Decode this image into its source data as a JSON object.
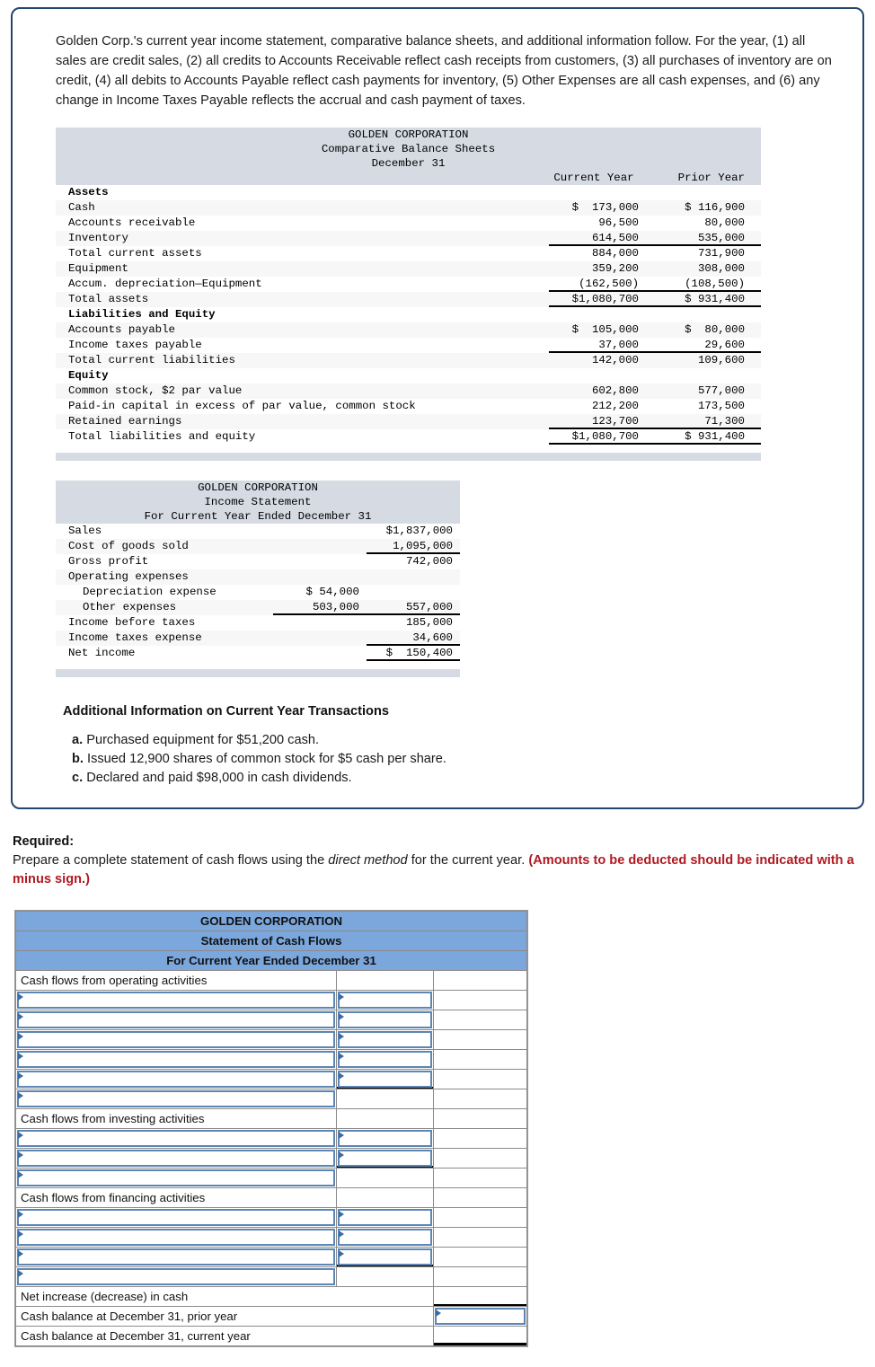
{
  "intro": "Golden Corp.'s current year income statement, comparative balance sheets, and additional information follow. For the year, (1) all sales are credit sales, (2) all credits to Accounts Receivable reflect cash receipts from customers, (3) all purchases of inventory are on credit, (4) all debits to Accounts Payable reflect cash payments for inventory, (5) Other Expenses are all cash expenses, and (6) any change in Income Taxes Payable reflects the accrual and cash payment of taxes.",
  "balance_sheet": {
    "title1": "GOLDEN CORPORATION",
    "title2": "Comparative Balance Sheets",
    "title3": "December 31",
    "col_current": "Current Year",
    "col_prior": "Prior Year",
    "rows": [
      {
        "label": "Assets",
        "bold": true,
        "current": "",
        "prior": ""
      },
      {
        "label": "Cash",
        "current": "$  173,000",
        "prior": "$ 116,900"
      },
      {
        "label": "Accounts receivable",
        "current": "96,500",
        "prior": "80,000"
      },
      {
        "label": "Inventory",
        "current": "614,500",
        "prior": "535,000",
        "rule": "single"
      },
      {
        "label": "Total current assets",
        "current": "884,000",
        "prior": "731,900"
      },
      {
        "label": "Equipment",
        "current": "359,200",
        "prior": "308,000"
      },
      {
        "label": "Accum. depreciation—Equipment",
        "current": "(162,500)",
        "prior": "(108,500)",
        "rule": "single"
      },
      {
        "label": "Total assets",
        "current": "$1,080,700",
        "prior": "$ 931,400",
        "rule": "double"
      },
      {
        "label": "Liabilities and Equity",
        "bold": true,
        "current": "",
        "prior": ""
      },
      {
        "label": "Accounts payable",
        "current": "$  105,000",
        "prior": "$  80,000"
      },
      {
        "label": "Income taxes payable",
        "current": "37,000",
        "prior": "29,600",
        "rule": "single"
      },
      {
        "label": "Total current liabilities",
        "current": "142,000",
        "prior": "109,600"
      },
      {
        "label": "Equity",
        "bold": true,
        "current": "",
        "prior": ""
      },
      {
        "label": "Common stock, $2 par value",
        "current": "602,800",
        "prior": "577,000"
      },
      {
        "label": "Paid-in capital in excess of par value, common stock",
        "current": "212,200",
        "prior": "173,500"
      },
      {
        "label": "Retained earnings",
        "current": "123,700",
        "prior": "71,300",
        "rule": "single"
      },
      {
        "label": "Total liabilities and equity",
        "current": "$1,080,700",
        "prior": "$ 931,400",
        "rule": "double"
      }
    ]
  },
  "income_statement": {
    "title1": "GOLDEN CORPORATION",
    "title2": "Income Statement",
    "title3": "For Current Year Ended December 31",
    "rows": [
      {
        "label": "Sales",
        "indent": false,
        "a": "",
        "b": "$1,837,000"
      },
      {
        "label": "Cost of goods sold",
        "indent": false,
        "a": "",
        "b": "1,095,000",
        "rule": "single"
      },
      {
        "label": "Gross profit",
        "indent": false,
        "a": "",
        "b": "742,000"
      },
      {
        "label": "Operating expenses",
        "indent": false,
        "a": "",
        "b": ""
      },
      {
        "label": "Depreciation expense",
        "indent": true,
        "a": "$ 54,000",
        "b": ""
      },
      {
        "label": "Other expenses",
        "indent": true,
        "a": "503,000",
        "b": "557,000",
        "rule": "single_both"
      },
      {
        "label": "Income before taxes",
        "indent": false,
        "a": "",
        "b": "185,000"
      },
      {
        "label": "Income taxes expense",
        "indent": false,
        "a": "",
        "b": "34,600",
        "rule": "single"
      },
      {
        "label": "Net income",
        "indent": false,
        "a": "",
        "b": "$  150,400",
        "rule": "double"
      }
    ]
  },
  "additional": {
    "heading": "Additional Information on Current Year Transactions",
    "items": [
      {
        "letter": "a.",
        "text": "Purchased equipment for $51,200 cash."
      },
      {
        "letter": "b.",
        "text": "Issued 12,900 shares of common stock for $5 cash per share."
      },
      {
        "letter": "c.",
        "text": "Declared and paid $98,000 in cash dividends."
      }
    ]
  },
  "required": {
    "label": "Required:",
    "text_before": "Prepare a complete statement of cash flows using the ",
    "text_italic": "direct method",
    "text_after": " for the current year. ",
    "text_red": "(Amounts to be deducted should be indicated with a minus sign.)"
  },
  "form": {
    "header1": "GOLDEN CORPORATION",
    "header2": "Statement of Cash Flows",
    "header3": "For Current Year Ended December 31",
    "section_operating": "Cash flows from operating activities",
    "section_investing": "Cash flows from investing activities",
    "section_financing": "Cash flows from financing activities",
    "net_increase": "Net increase (decrease) in cash",
    "cash_prior": "Cash balance at December 31, prior year",
    "cash_current": "Cash balance at December 31, current year",
    "input_value": "",
    "operating_input_rows": 5,
    "investing_input_rows": 2,
    "financing_input_rows": 3
  },
  "colors": {
    "card_border": "#24456e",
    "header_blue": "#7ba7dc",
    "shade_gray": "#d5dae3",
    "input_border": "#5d86b4",
    "red_text": "#b01a22"
  }
}
